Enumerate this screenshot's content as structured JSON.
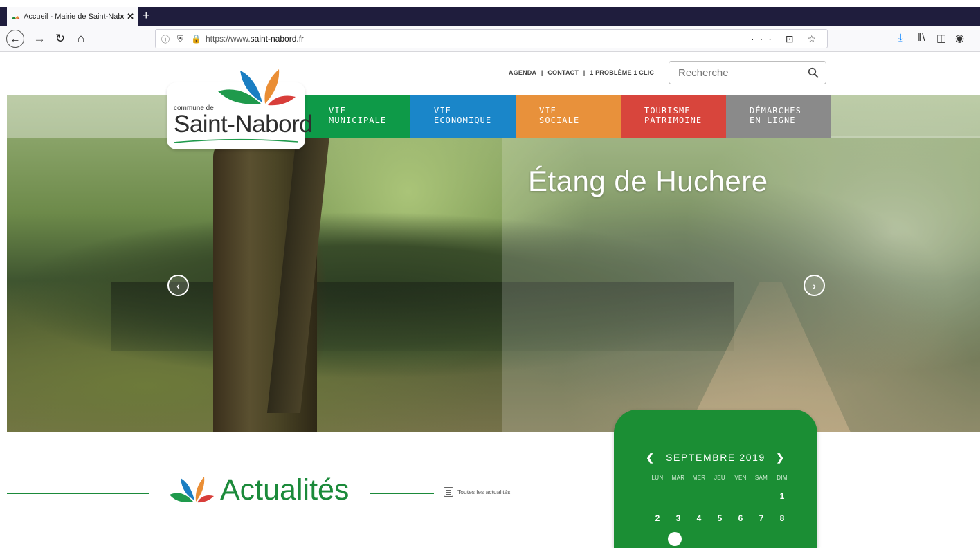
{
  "browser": {
    "tab_title": "Accueil - Mairie de Saint-Nabo",
    "tab_close": "✕",
    "new_tab": "+",
    "url_prefix": "https://www.",
    "url_domain": "saint-nabord.fr",
    "url_actions": "··· ⊡ ☆",
    "icons": [
      "back-icon",
      "forward-icon",
      "reload-icon",
      "home-icon",
      "info-icon",
      "shield-icon",
      "lock-icon",
      "download-icon",
      "library-icon",
      "sidebar-icon",
      "account-icon"
    ]
  },
  "header": {
    "top_links": [
      "AGENDA",
      "CONTACT",
      "1 PROBLÈME 1 CLIC"
    ],
    "separator": "|",
    "search_placeholder": "Recherche"
  },
  "logo": {
    "small": "commune de",
    "big": "Saint-Nabord"
  },
  "menu": [
    {
      "line1": "VIE",
      "line2": "MUNICIPALE",
      "color": "#0e9a48"
    },
    {
      "line1": "VIE",
      "line2": "ÉCONOMIQUE",
      "color": "#1a86c9"
    },
    {
      "line1": "VIE",
      "line2": "SOCIALE",
      "color": "#e8913b"
    },
    {
      "line1": "TOURISME",
      "line2": "PATRIMOINE",
      "color": "#d8453c"
    },
    {
      "line1": "DÉMARCHES",
      "line2": "EN LIGNE",
      "color": "#8a8a8a"
    }
  ],
  "hero": {
    "title": "Étang de Huchere",
    "prev": "‹",
    "next": "›"
  },
  "news": {
    "title": "Actualités",
    "all_link": "Toutes les actualités",
    "accent": "#1b8a3a"
  },
  "calendar": {
    "prev": "❮",
    "month": "SEPTEMBRE 2019",
    "next": "❯",
    "weekdays": [
      "LUN",
      "MAR",
      "MER",
      "JEU",
      "VEN",
      "SAM",
      "DIM"
    ],
    "week1": [
      "",
      "",
      "",
      "",
      "",
      "",
      "1"
    ],
    "week2": [
      "2",
      "3",
      "4",
      "5",
      "6",
      "7",
      "8"
    ],
    "color": "#1b8e34"
  }
}
